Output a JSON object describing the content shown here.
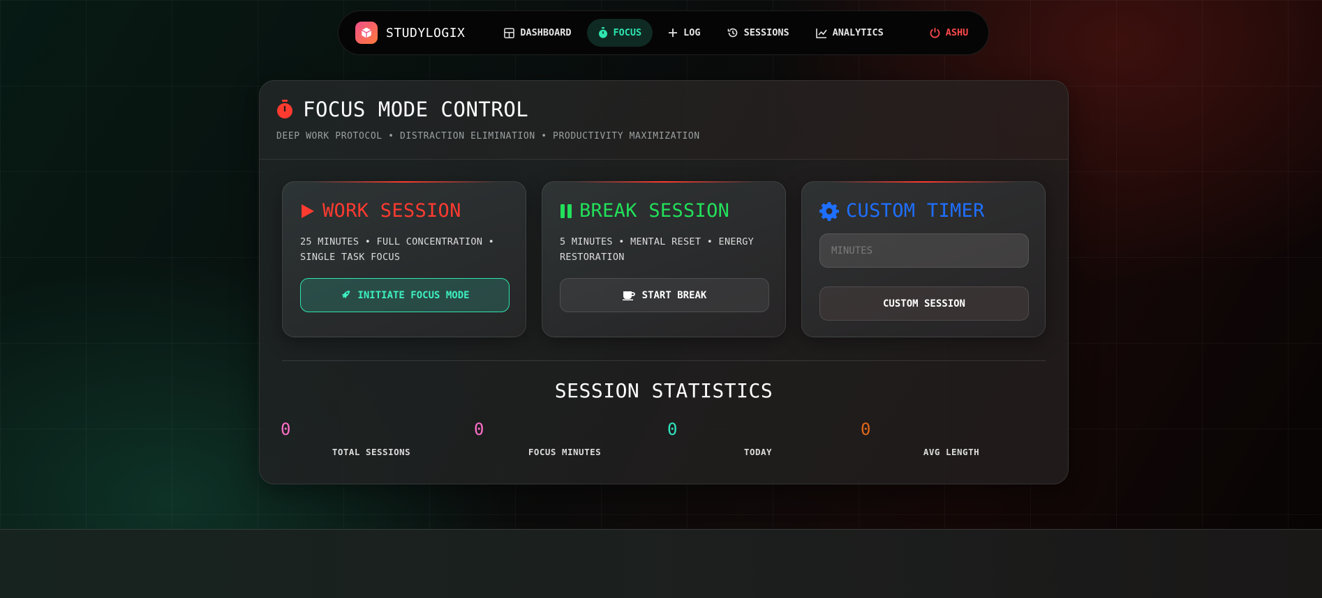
{
  "nav": {
    "brand": "STUDYLOGIX",
    "items": [
      {
        "label": "DASHBOARD",
        "icon": "dashboard-grid-icon"
      },
      {
        "label": "FOCUS",
        "icon": "stopwatch-icon",
        "active": true
      },
      {
        "label": "LOG",
        "icon": "plus-icon"
      },
      {
        "label": "SESSIONS",
        "icon": "history-icon"
      },
      {
        "label": "ANALYTICS",
        "icon": "line-chart-icon"
      }
    ],
    "user": {
      "label": "ASHU",
      "icon": "power-icon"
    }
  },
  "panel": {
    "title": "FOCUS MODE CONTROL",
    "subtitle": "DEEP WORK PROTOCOL • DISTRACTION ELIMINATION • PRODUCTIVITY MAXIMIZATION"
  },
  "cards": {
    "work": {
      "title": "WORK SESSION",
      "description": "25 MINUTES • FULL CONCENTRATION • SINGLE TASK FOCUS",
      "button": "INITIATE FOCUS MODE",
      "color": "#ff3b30"
    },
    "break": {
      "title": "BREAK SESSION",
      "description": "5 MINUTES • MENTAL RESET • ENERGY RESTORATION",
      "button": "START BREAK",
      "color": "#22e05a"
    },
    "custom": {
      "title": "CUSTOM TIMER",
      "input_placeholder": "MINUTES",
      "button": "CUSTOM SESSION",
      "color": "#1f6fff"
    }
  },
  "stats": {
    "title": "SESSION STATISTICS",
    "items": [
      {
        "value": "0",
        "label": "TOTAL SESSIONS",
        "color": "#ff6ec7"
      },
      {
        "value": "0",
        "label": "FOCUS MINUTES",
        "color": "#ff6ec7"
      },
      {
        "value": "0",
        "label": "TODAY",
        "color": "#2ee6c0"
      },
      {
        "value": "0",
        "label": "AVG LENGTH",
        "color": "#e0661a"
      }
    ]
  },
  "colors": {
    "accent": "#2ee6b0",
    "danger": "#ff4a4a"
  }
}
